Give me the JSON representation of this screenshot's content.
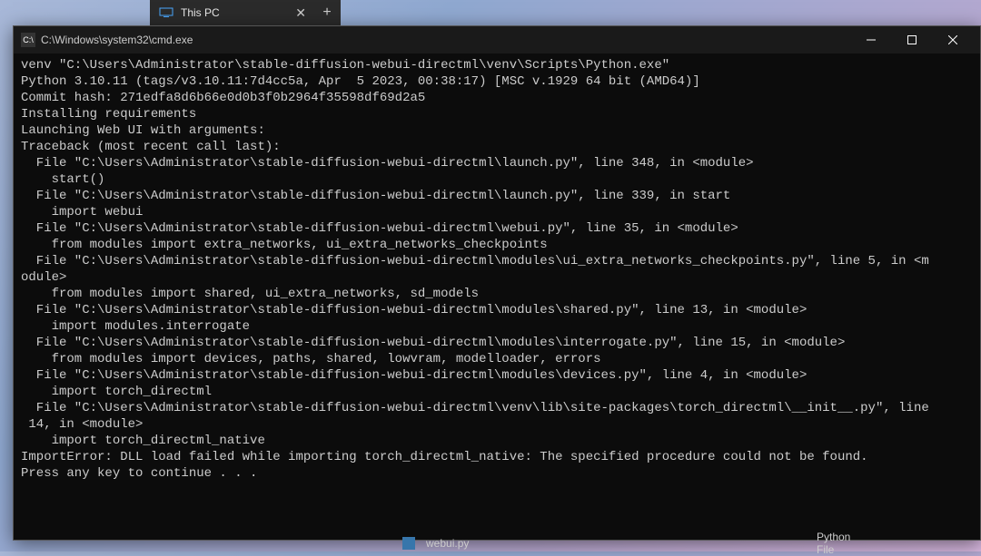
{
  "tab": {
    "title": "This PC"
  },
  "cmd": {
    "title": "C:\\Windows\\system32\\cmd.exe"
  },
  "terminal_lines": [
    "venv \"C:\\Users\\Administrator\\stable-diffusion-webui-directml\\venv\\Scripts\\Python.exe\"",
    "Python 3.10.11 (tags/v3.10.11:7d4cc5a, Apr  5 2023, 00:38:17) [MSC v.1929 64 bit (AMD64)]",
    "Commit hash: 271edfa8d6b66e0d0b3f0b2964f35598df69d2a5",
    "Installing requirements",
    "Launching Web UI with arguments:",
    "Traceback (most recent call last):",
    "  File \"C:\\Users\\Administrator\\stable-diffusion-webui-directml\\launch.py\", line 348, in <module>",
    "    start()",
    "  File \"C:\\Users\\Administrator\\stable-diffusion-webui-directml\\launch.py\", line 339, in start",
    "    import webui",
    "  File \"C:\\Users\\Administrator\\stable-diffusion-webui-directml\\webui.py\", line 35, in <module>",
    "    from modules import extra_networks, ui_extra_networks_checkpoints",
    "  File \"C:\\Users\\Administrator\\stable-diffusion-webui-directml\\modules\\ui_extra_networks_checkpoints.py\", line 5, in <m",
    "odule>",
    "    from modules import shared, ui_extra_networks, sd_models",
    "  File \"C:\\Users\\Administrator\\stable-diffusion-webui-directml\\modules\\shared.py\", line 13, in <module>",
    "    import modules.interrogate",
    "  File \"C:\\Users\\Administrator\\stable-diffusion-webui-directml\\modules\\interrogate.py\", line 15, in <module>",
    "    from modules import devices, paths, shared, lowvram, modelloader, errors",
    "  File \"C:\\Users\\Administrator\\stable-diffusion-webui-directml\\modules\\devices.py\", line 4, in <module>",
    "    import torch_directml",
    "  File \"C:\\Users\\Administrator\\stable-diffusion-webui-directml\\venv\\lib\\site-packages\\torch_directml\\__init__.py\", line",
    " 14, in <module>",
    "    import torch_directml_native",
    "ImportError: DLL load failed while importing torch_directml_native: The specified procedure could not be found.",
    "Press any key to continue . . ."
  ],
  "bottom": {
    "filename": "webui.py",
    "filetype": "Python File"
  }
}
